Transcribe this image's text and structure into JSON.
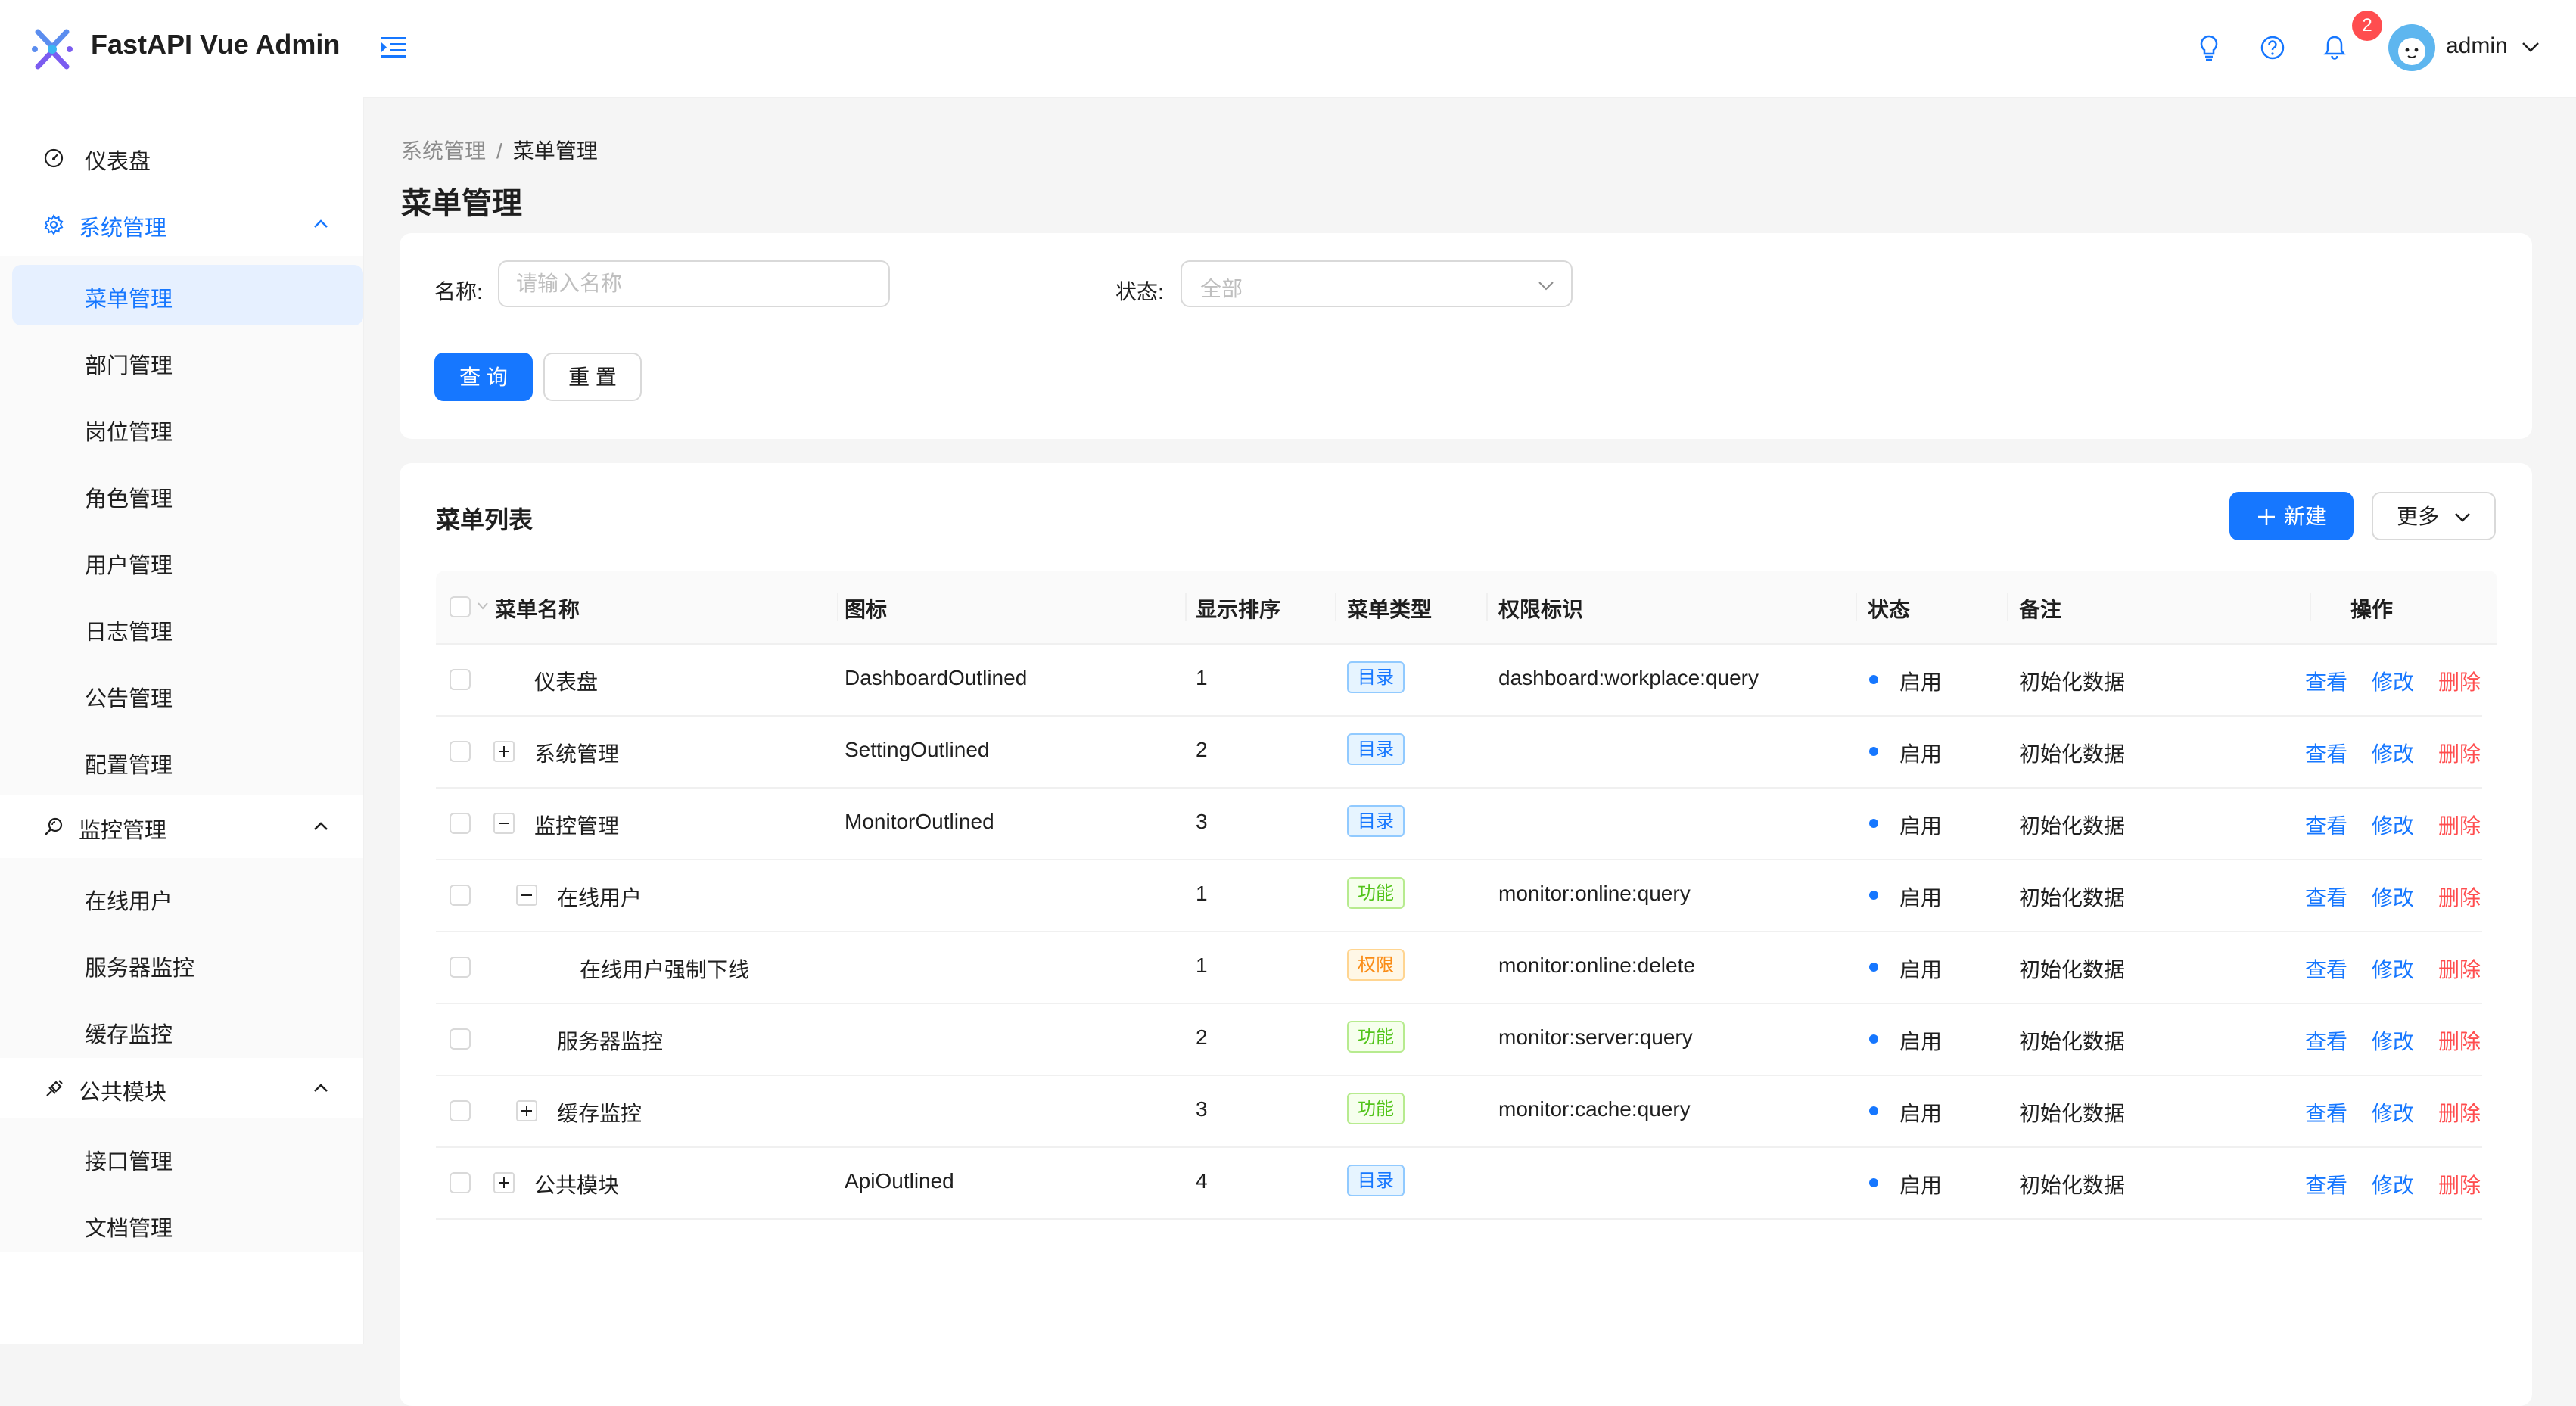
{
  "app": {
    "title": "FastAPI Vue Admin"
  },
  "header": {
    "notifications_count": "2",
    "username": "admin"
  },
  "sidebar": {
    "dashboard": "仪表盘",
    "system": {
      "label": "系统管理",
      "items": [
        "菜单管理",
        "部门管理",
        "岗位管理",
        "角色管理",
        "用户管理",
        "日志管理",
        "公告管理",
        "配置管理"
      ]
    },
    "monitor": {
      "label": "监控管理",
      "items": [
        "在线用户",
        "服务器监控",
        "缓存监控"
      ]
    },
    "common": {
      "label": "公共模块",
      "items": [
        "接口管理",
        "文档管理"
      ]
    }
  },
  "breadcrumb": [
    "系统管理",
    "菜单管理"
  ],
  "page_title": "菜单管理",
  "search": {
    "name_label": "名称:",
    "name_placeholder": "请输入名称",
    "status_label": "状态:",
    "status_placeholder": "全部",
    "query_label": "查 询",
    "reset_label": "重 置"
  },
  "table": {
    "title": "菜单列表",
    "new_label": "新建",
    "more_label": "更多",
    "columns": [
      "菜单名称",
      "图标",
      "显示排序",
      "菜单类型",
      "权限标识",
      "状态",
      "备注",
      "操作"
    ],
    "actions": {
      "view": "查看",
      "edit": "修改",
      "delete": "删除"
    },
    "rows": [
      {
        "name": "仪表盘",
        "icon": "DashboardOutlined",
        "order": "1",
        "type": "目录",
        "perm": "dashboard:workplace:query",
        "status": "启用",
        "remark": "初始化数据"
      },
      {
        "name": "系统管理",
        "icon": "SettingOutlined",
        "order": "2",
        "type": "目录",
        "perm": "",
        "status": "启用",
        "remark": "初始化数据"
      },
      {
        "name": "监控管理",
        "icon": "MonitorOutlined",
        "order": "3",
        "type": "目录",
        "perm": "",
        "status": "启用",
        "remark": "初始化数据"
      },
      {
        "name": "在线用户",
        "icon": "",
        "order": "1",
        "type": "功能",
        "perm": "monitor:online:query",
        "status": "启用",
        "remark": "初始化数据"
      },
      {
        "name": "在线用户强制下线",
        "icon": "",
        "order": "1",
        "type": "权限",
        "perm": "monitor:online:delete",
        "status": "启用",
        "remark": "初始化数据"
      },
      {
        "name": "服务器监控",
        "icon": "",
        "order": "2",
        "type": "功能",
        "perm": "monitor:server:query",
        "status": "启用",
        "remark": "初始化数据"
      },
      {
        "name": "缓存监控",
        "icon": "",
        "order": "3",
        "type": "功能",
        "perm": "monitor:cache:query",
        "status": "启用",
        "remark": "初始化数据"
      },
      {
        "name": "公共模块",
        "icon": "ApiOutlined",
        "order": "4",
        "type": "目录",
        "perm": "",
        "status": "启用",
        "remark": "初始化数据"
      }
    ]
  },
  "colors": {
    "primary": "#1677ff",
    "danger": "#ff4d4f",
    "success": "#52c41a",
    "warning": "#fa8c16"
  }
}
